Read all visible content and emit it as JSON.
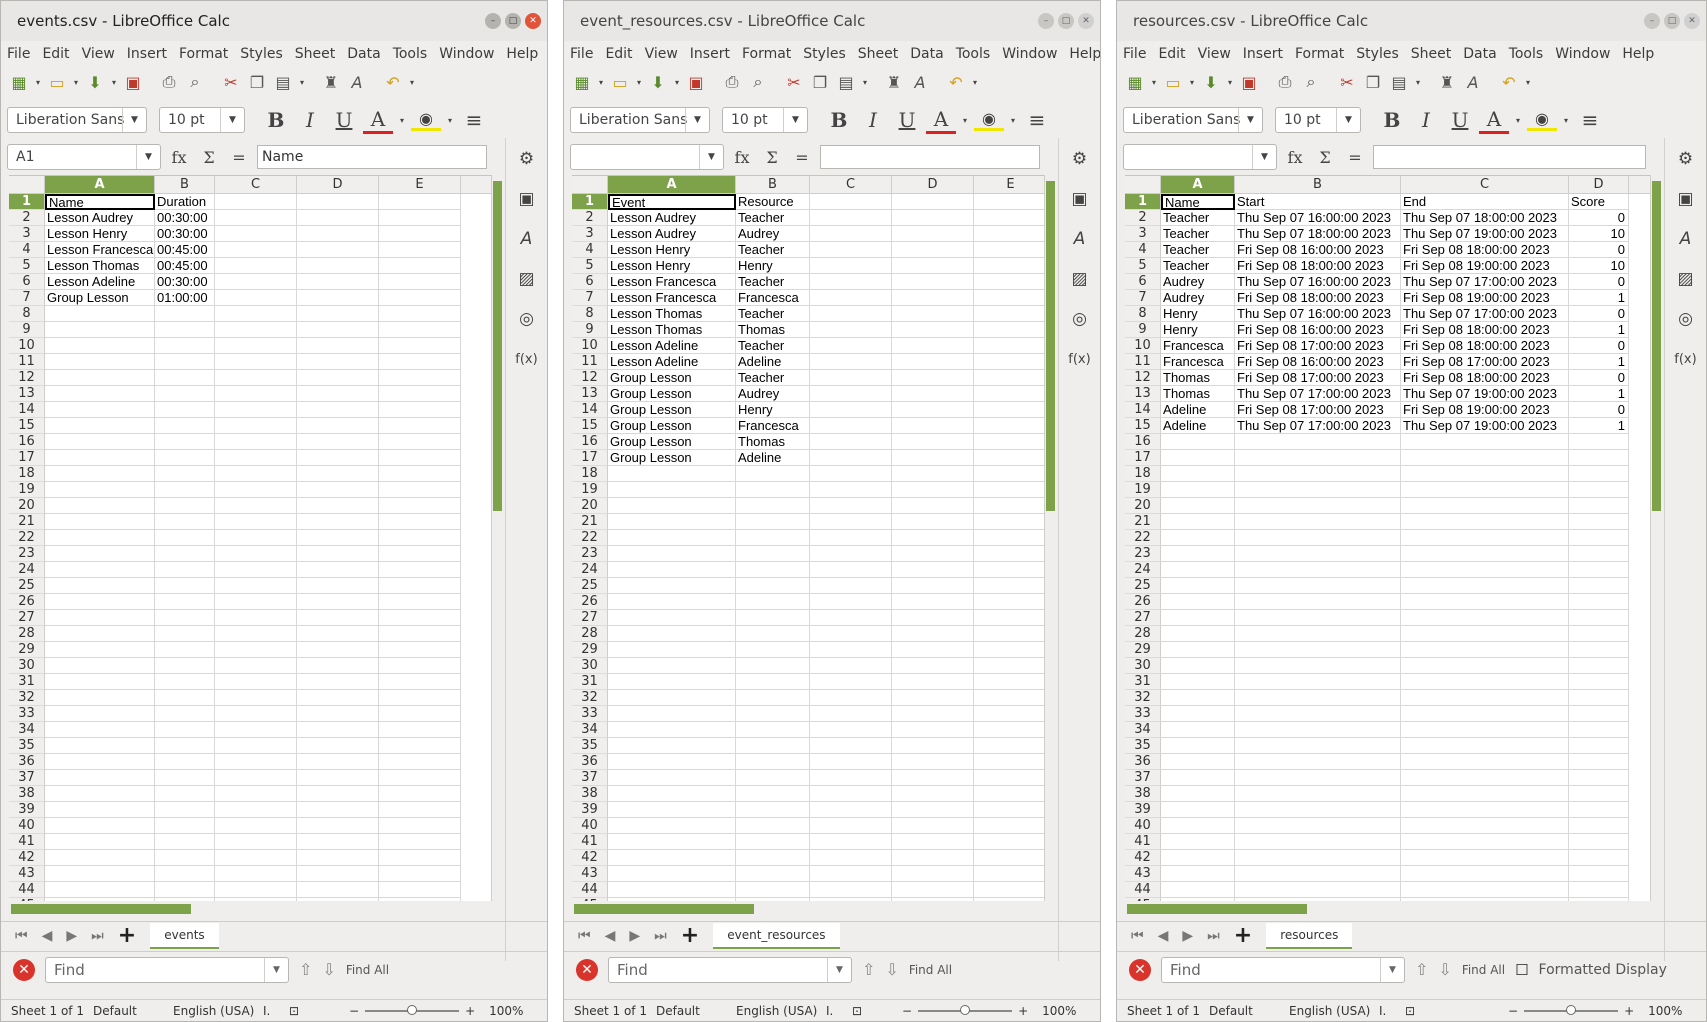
{
  "menu": [
    "File",
    "Edit",
    "View",
    "Insert",
    "Format",
    "Styles",
    "Sheet",
    "Data",
    "Tools",
    "Window",
    "Help"
  ],
  "font_name": "Liberation Sans",
  "font_size": "10 pt",
  "find_placeholder": "Find",
  "find_all": "Find All",
  "status_sheet": "Sheet 1 of 1",
  "status_style": "Default",
  "status_lang": "English (USA)",
  "status_zoom": "100%",
  "accent_color": "#7da24a",
  "windows": [
    {
      "title": "events.csv - LibreOffice Calc",
      "active": true,
      "name_box": "A1",
      "formula": "Name",
      "sheet_tab": "events",
      "columns": [
        "A",
        "B",
        "C",
        "D",
        "E"
      ],
      "rows": [
        [
          "Name",
          "Duration"
        ],
        [
          "Lesson Audrey",
          "00:30:00"
        ],
        [
          "Lesson Henry",
          "00:30:00"
        ],
        [
          "Lesson Francesca",
          "00:45:00"
        ],
        [
          "Lesson Thomas",
          "00:45:00"
        ],
        [
          "Lesson Adeline",
          "00:30:00"
        ],
        [
          "Group Lesson",
          "01:00:00"
        ]
      ],
      "row_count": 45,
      "formatted_display": null
    },
    {
      "title": "event_resources.csv - LibreOffice Calc",
      "active": false,
      "name_box": "",
      "formula": "",
      "sheet_tab": "event_resources",
      "columns": [
        "A",
        "B",
        "C",
        "D",
        "E"
      ],
      "rows": [
        [
          "Event",
          "Resource"
        ],
        [
          "Lesson Audrey",
          "Teacher"
        ],
        [
          "Lesson Audrey",
          "Audrey"
        ],
        [
          "Lesson Henry",
          "Teacher"
        ],
        [
          "Lesson Henry",
          "Henry"
        ],
        [
          "Lesson Francesca",
          "Teacher"
        ],
        [
          "Lesson Francesca",
          "Francesca"
        ],
        [
          "Lesson Thomas",
          "Teacher"
        ],
        [
          "Lesson Thomas",
          "Thomas"
        ],
        [
          "Lesson Adeline",
          "Teacher"
        ],
        [
          "Lesson Adeline",
          "Adeline"
        ],
        [
          "Group Lesson",
          "Teacher"
        ],
        [
          "Group Lesson",
          "Audrey"
        ],
        [
          "Group Lesson",
          "Henry"
        ],
        [
          "Group Lesson",
          "Francesca"
        ],
        [
          "Group Lesson",
          "Thomas"
        ],
        [
          "Group Lesson",
          "Adeline"
        ]
      ],
      "row_count": 45,
      "formatted_display": null
    },
    {
      "title": "resources.csv - LibreOffice Calc",
      "active": false,
      "name_box": "",
      "formula": "",
      "sheet_tab": "resources",
      "columns": [
        "A",
        "B",
        "C",
        "D"
      ],
      "rows": [
        [
          "Name",
          "Start",
          "End",
          "Score"
        ],
        [
          "Teacher",
          "Thu Sep 07 16:00:00 2023",
          "Thu Sep 07 18:00:00 2023",
          "0"
        ],
        [
          "Teacher",
          "Thu Sep 07 18:00:00 2023",
          "Thu Sep 07 19:00:00 2023",
          "10"
        ],
        [
          "Teacher",
          "Fri Sep 08 16:00:00 2023",
          "Fri Sep 08 18:00:00 2023",
          "0"
        ],
        [
          "Teacher",
          "Fri Sep 08 18:00:00 2023",
          "Fri Sep 08 19:00:00 2023",
          "10"
        ],
        [
          "Audrey",
          "Thu Sep 07 16:00:00 2023",
          "Thu Sep 07 17:00:00 2023",
          "0"
        ],
        [
          "Audrey",
          "Fri Sep 08 18:00:00 2023",
          "Fri Sep 08 19:00:00 2023",
          "1"
        ],
        [
          "Henry",
          "Thu Sep 07 16:00:00 2023",
          "Thu Sep 07 17:00:00 2023",
          "0"
        ],
        [
          "Henry",
          "Fri Sep 08 16:00:00 2023",
          "Fri Sep 08 18:00:00 2023",
          "1"
        ],
        [
          "Francesca",
          "Fri Sep 08 17:00:00 2023",
          "Fri Sep 08 18:00:00 2023",
          "0"
        ],
        [
          "Francesca",
          "Fri Sep 08 16:00:00 2023",
          "Fri Sep 08 17:00:00 2023",
          "1"
        ],
        [
          "Thomas",
          "Fri Sep 08 17:00:00 2023",
          "Fri Sep 08 18:00:00 2023",
          "0"
        ],
        [
          "Thomas",
          "Thu Sep 07 17:00:00 2023",
          "Thu Sep 07 19:00:00 2023",
          "1"
        ],
        [
          "Adeline",
          "Fri Sep 08 17:00:00 2023",
          "Fri Sep 08 19:00:00 2023",
          "0"
        ],
        [
          "Adeline",
          "Thu Sep 07 17:00:00 2023",
          "Thu Sep 07 19:00:00 2023",
          "1"
        ]
      ],
      "row_count": 45,
      "formatted_display": "Formatted Display"
    }
  ]
}
